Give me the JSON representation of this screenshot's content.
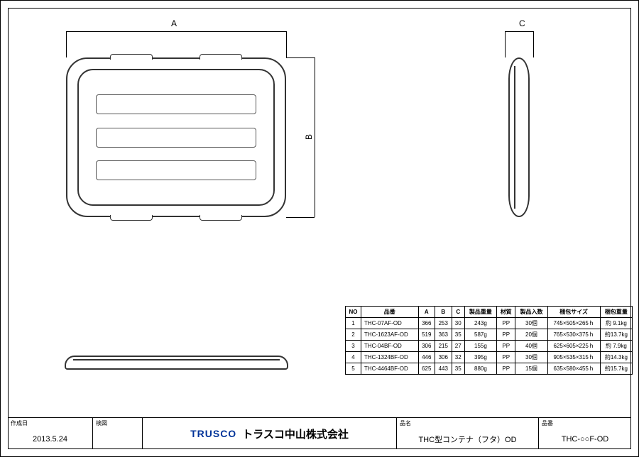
{
  "dimensions": {
    "a": "A",
    "b": "B",
    "c": "C"
  },
  "table": {
    "headers": {
      "no": "NO",
      "partnum": "品番",
      "a": "A",
      "b": "B",
      "c": "C",
      "weight": "製品重量",
      "material": "材質",
      "qty": "製品入数",
      "packsize": "梱包サイズ",
      "packweight": "梱包重量"
    },
    "rows": [
      {
        "no": "1",
        "pn": "THC-07AF-OD",
        "a": "366",
        "b": "253",
        "c": "30",
        "w": "243g",
        "m": "PP",
        "q": "30個",
        "ps": "745×505×265ｈ",
        "pw": "約 9.1kg"
      },
      {
        "no": "2",
        "pn": "THC-1623AF-OD",
        "a": "519",
        "b": "363",
        "c": "35",
        "w": "587g",
        "m": "PP",
        "q": "20個",
        "ps": "765×530×375ｈ",
        "pw": "約13.7kg"
      },
      {
        "no": "3",
        "pn": "THC-04BF-OD",
        "a": "306",
        "b": "215",
        "c": "27",
        "w": "155g",
        "m": "PP",
        "q": "40個",
        "ps": "625×605×225ｈ",
        "pw": "約 7.9kg"
      },
      {
        "no": "4",
        "pn": "THC-1324BF-OD",
        "a": "446",
        "b": "306",
        "c": "32",
        "w": "395g",
        "m": "PP",
        "q": "30個",
        "ps": "905×535×315ｈ",
        "pw": "約14.3kg"
      },
      {
        "no": "5",
        "pn": "THC-4464BF-OD",
        "a": "625",
        "b": "443",
        "c": "35",
        "w": "880g",
        "m": "PP",
        "q": "15個",
        "ps": "635×580×455ｈ",
        "pw": "約15.7kg"
      }
    ]
  },
  "titleblock": {
    "date_label": "作成日",
    "date_value": "2013.5.24",
    "check_label": "検図",
    "brand": "TRUSCO",
    "company": "トラスコ中山株式会社",
    "pname_label": "品名",
    "pname_value": "THC型コンテナ（フタ）OD",
    "pnum_label": "品番",
    "pnum_value": "THC-○○F-OD"
  }
}
